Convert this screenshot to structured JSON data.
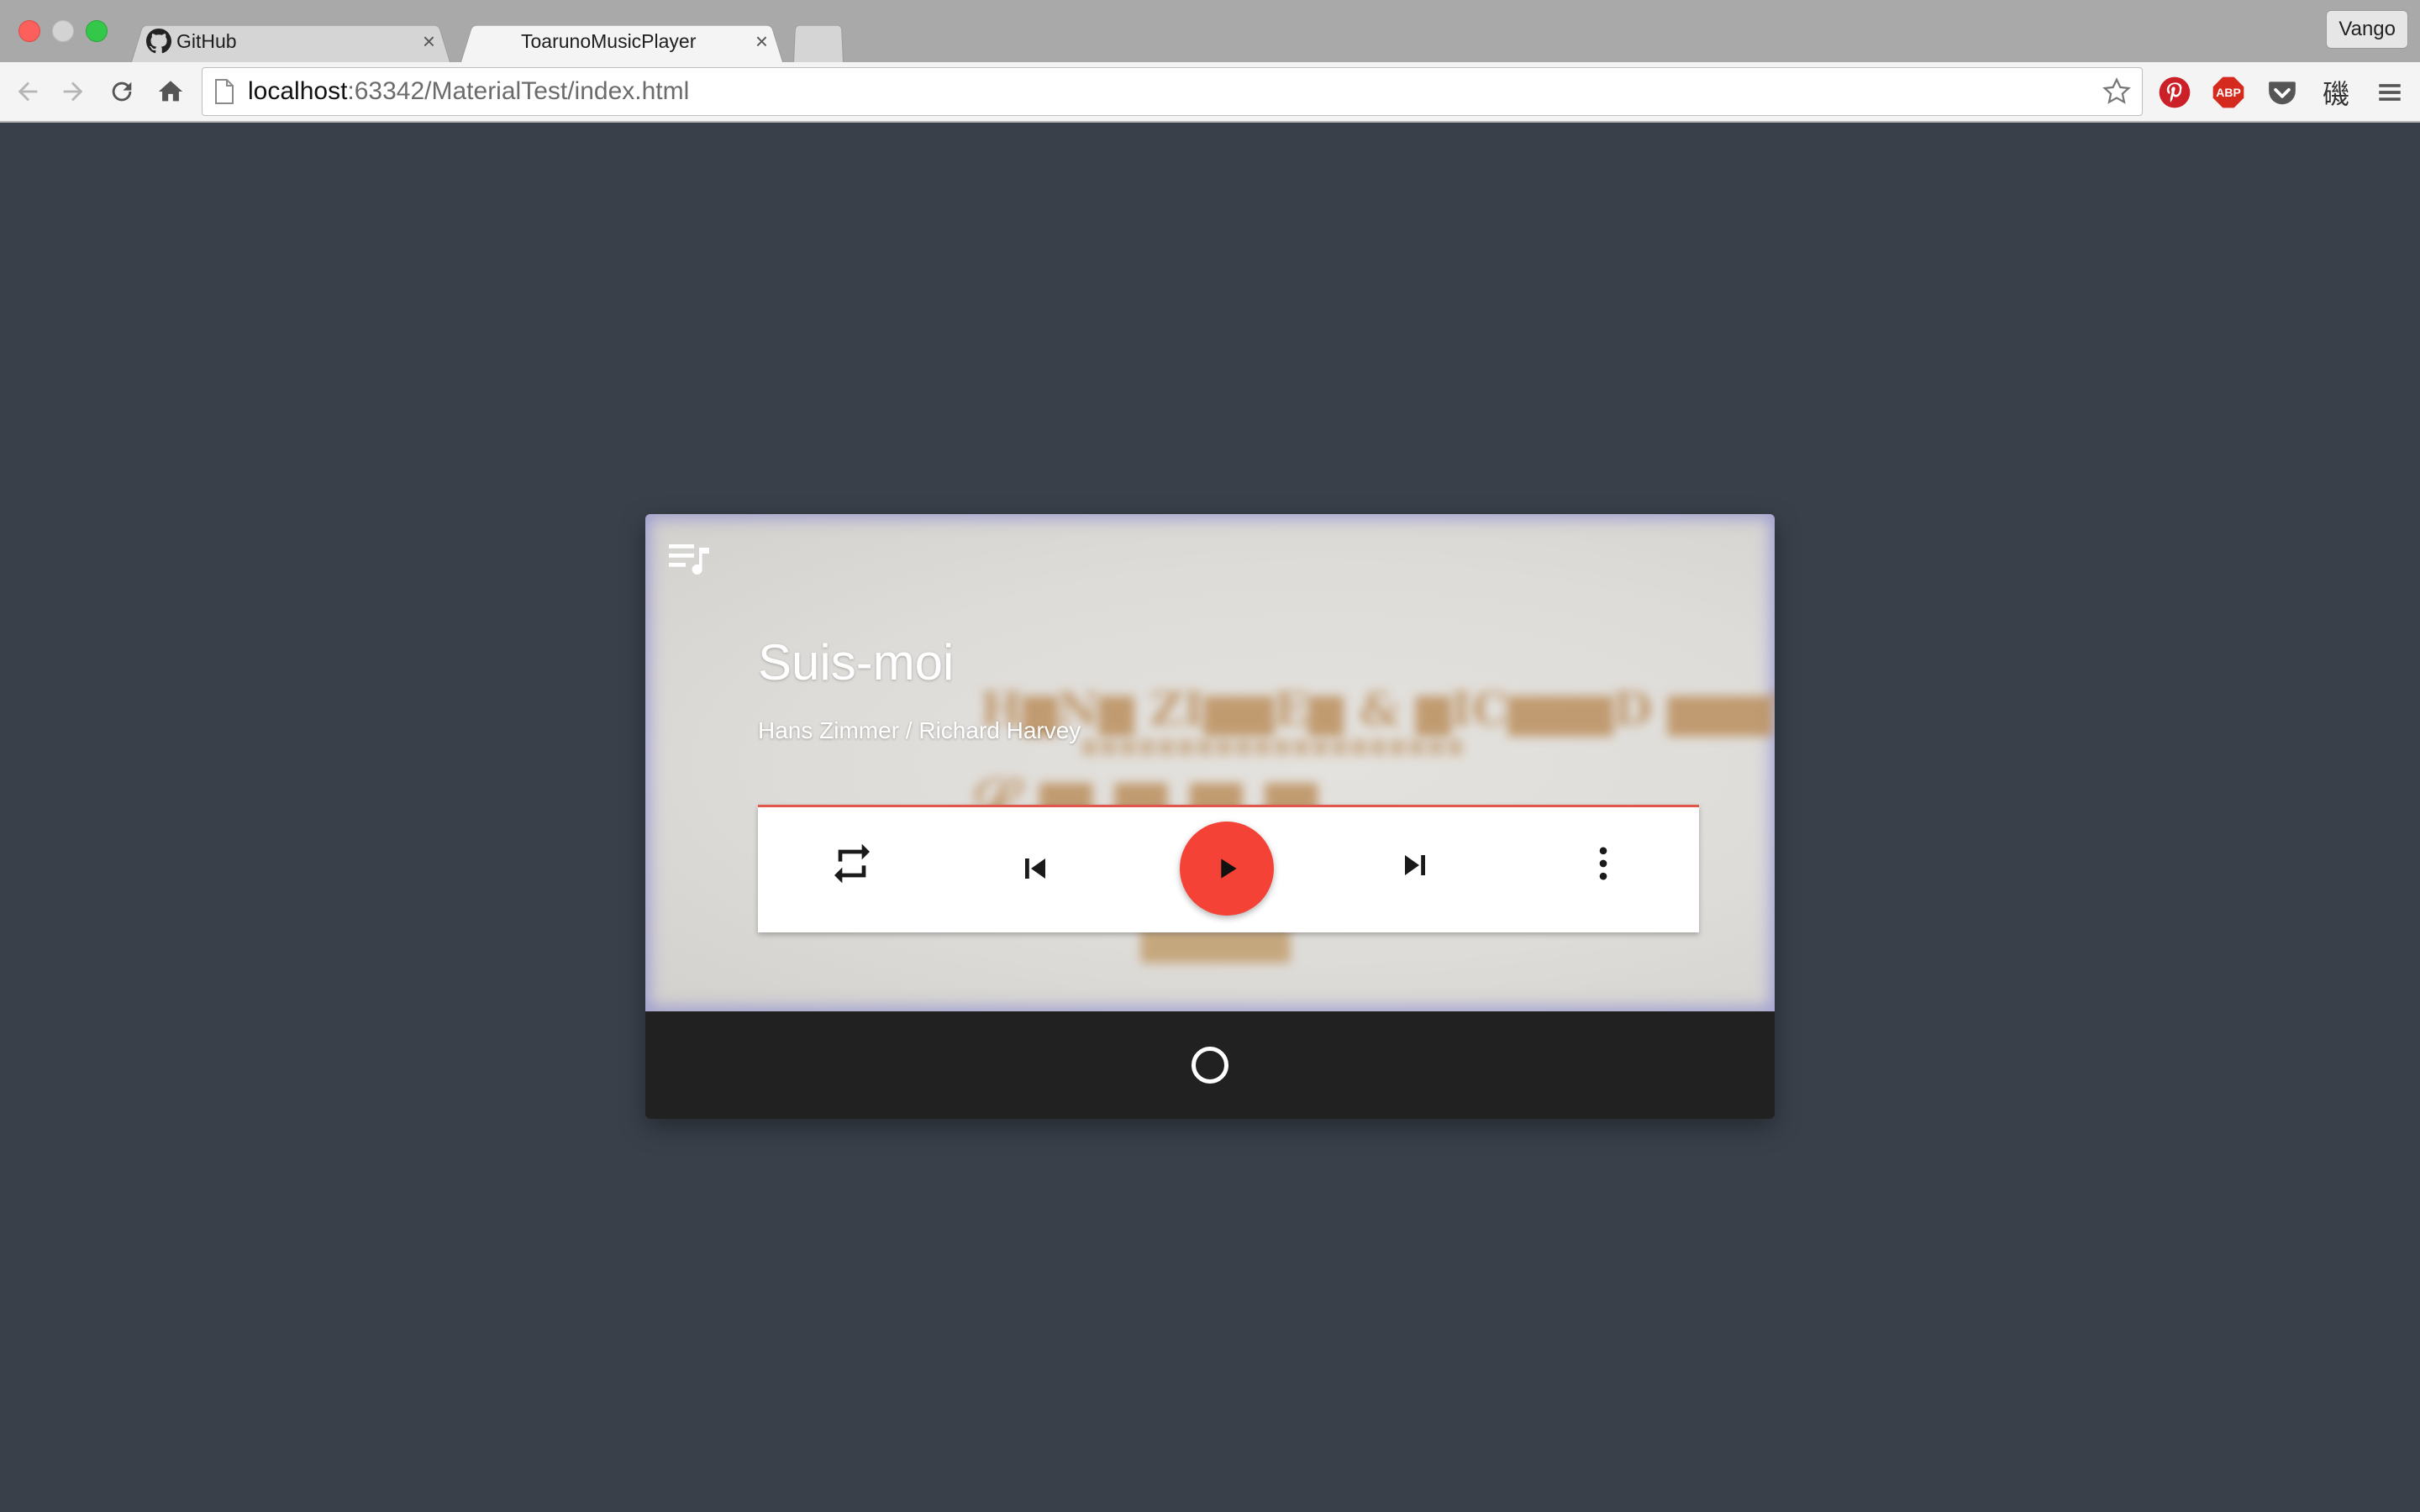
{
  "window": {
    "tabs": [
      {
        "label": "GitHub",
        "icon": "github-icon",
        "active": false
      },
      {
        "label": "ToarunoMusicPlayer",
        "active": true
      }
    ],
    "profile_label": "Vango"
  },
  "toolbar": {
    "url_host": "localhost",
    "url_rest": ":63342/MaterialTest/index.html",
    "extensions": [
      "pinterest-icon",
      "adblock-icon",
      "pocket-icon",
      "kanji-icon",
      "menu-icon"
    ],
    "abp_text": "ABP",
    "kanji_text": "磯"
  },
  "player": {
    "title": "Suis-moi",
    "artist": "Hans Zimmer / Richard Harvey",
    "accent_color": "#f44336",
    "controls": [
      "repeat-icon",
      "skip-previous-icon",
      "play-icon",
      "skip-next-icon",
      "more-vert-icon"
    ],
    "bottom_icon": "circle-icon"
  }
}
